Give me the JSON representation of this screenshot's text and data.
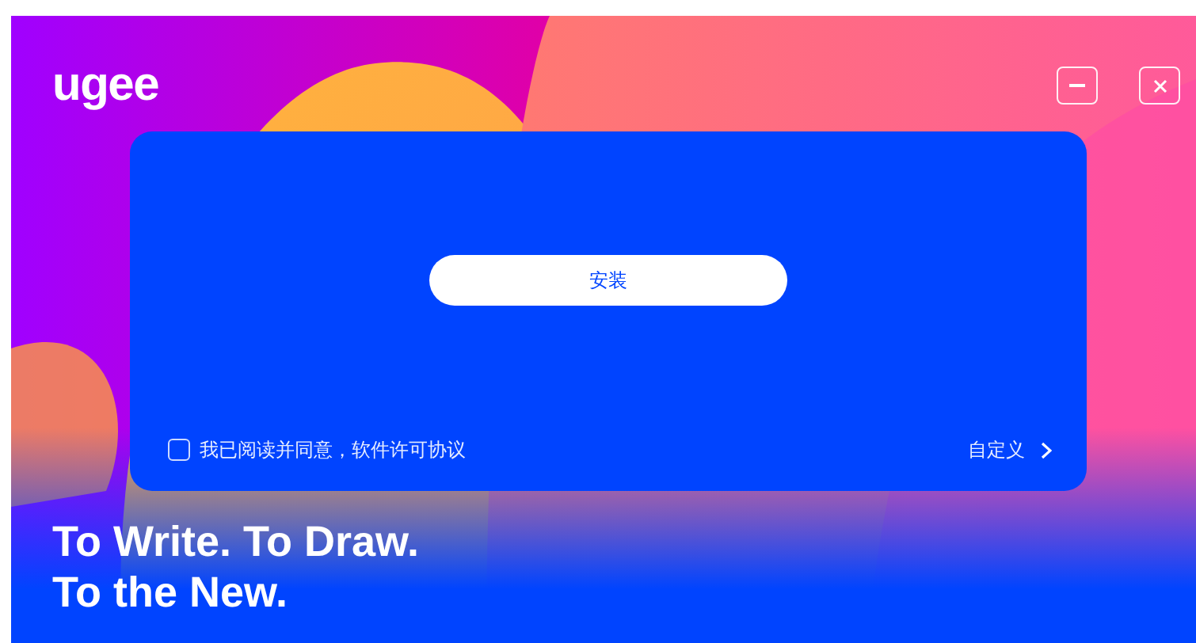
{
  "logo": "ugee",
  "window_controls": [
    {
      "kind": "minimize"
    },
    {
      "kind": "close"
    }
  ],
  "install_button": {
    "label": "安装"
  },
  "agreement": {
    "label": "我已阅读并同意，软件许可协议",
    "checked": false
  },
  "customize": {
    "label": "自定义"
  },
  "slogan": [
    "To Write. To Draw.",
    "To the New."
  ]
}
